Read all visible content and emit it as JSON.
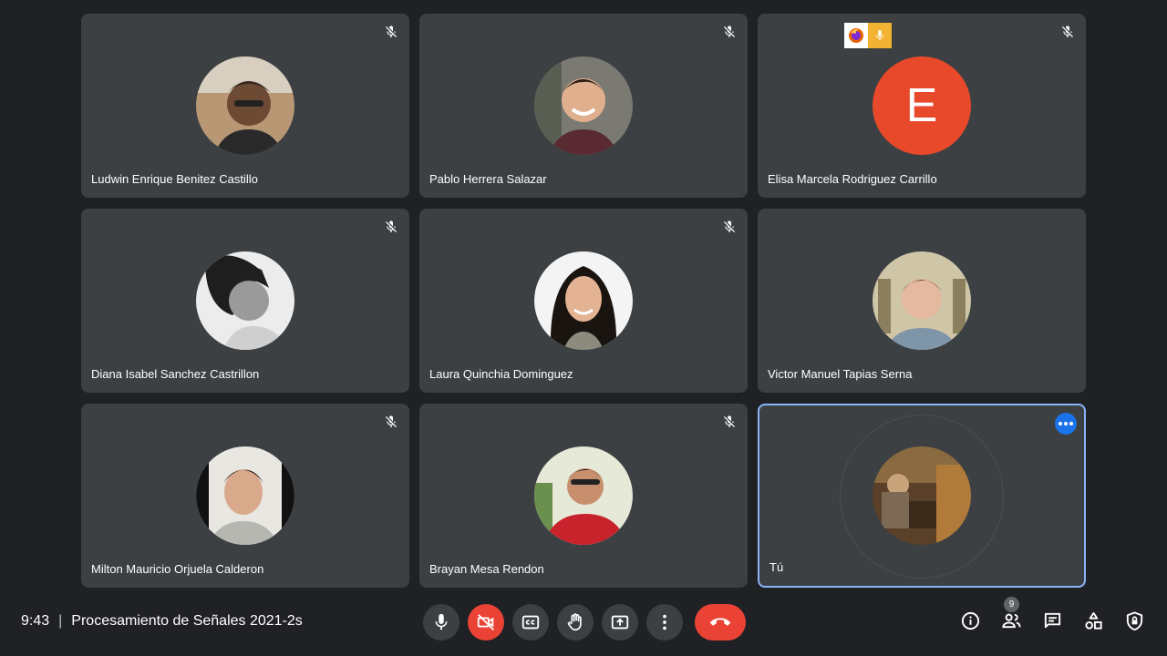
{
  "meeting": {
    "time": "9:43",
    "separator": "|",
    "title": "Procesamiento de Señales 2021-2s"
  },
  "participants": [
    {
      "name": "Ludwin Enrique Benitez Castillo",
      "avatar": "photo",
      "muted": true
    },
    {
      "name": "Pablo Herrera Salazar",
      "avatar": "photo",
      "muted": true
    },
    {
      "name": "Elisa Marcela Rodriguez Carrillo",
      "avatar": "letter",
      "letter": "E",
      "avatar_color": "#e8492b",
      "muted": true,
      "badges": [
        "firefox-icon",
        "microphone-icon"
      ]
    },
    {
      "name": "Diana Isabel Sanchez Castrillon",
      "avatar": "photo",
      "muted": true
    },
    {
      "name": "Laura Quinchia Dominguez",
      "avatar": "photo",
      "muted": true
    },
    {
      "name": "Victor Manuel Tapias Serna",
      "avatar": "photo",
      "muted": false
    },
    {
      "name": "Milton Mauricio Orjuela Calderon",
      "avatar": "photo",
      "muted": true
    },
    {
      "name": "Brayan Mesa Rendon",
      "avatar": "photo",
      "muted": true
    },
    {
      "name": "Tú",
      "avatar": "photo",
      "muted": false,
      "self": true
    }
  ],
  "controls": {
    "microphone": "microphone-icon",
    "camera": "camera-off-icon",
    "captions": "closed-captions-icon",
    "raise_hand": "raise-hand-icon",
    "present": "present-screen-icon",
    "more": "more-options-icon",
    "hangup": "hang-up-icon"
  },
  "side_panel": {
    "people_count": "9",
    "icons": [
      "info-icon",
      "people-icon",
      "chat-icon",
      "activities-icon",
      "host-controls-icon"
    ]
  },
  "colors": {
    "background": "#202124",
    "tile": "#3c4043",
    "accent_blue": "#8ab4f8",
    "danger_red": "#ea4335"
  }
}
